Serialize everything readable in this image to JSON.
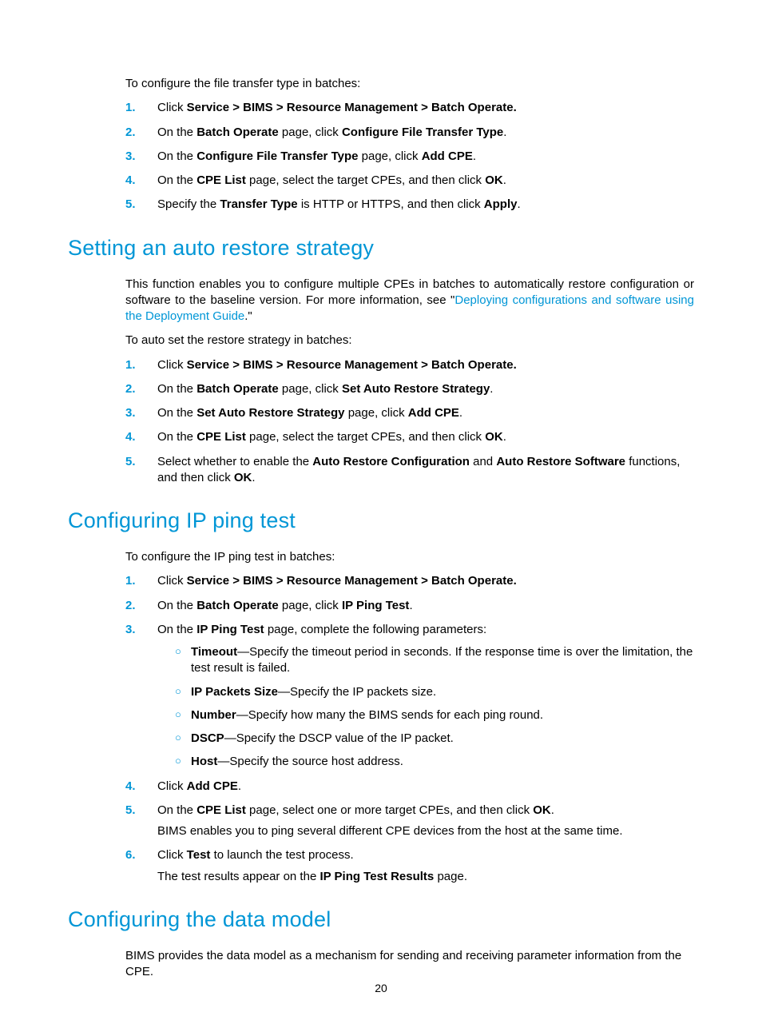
{
  "page_number": "20",
  "section_a": {
    "intro": "To configure the file transfer type in batches:",
    "steps": [
      {
        "n": "1.",
        "pre": "Click ",
        "bold": "Service > BIMS > Resource Management > Batch Operate.",
        "post": ""
      },
      {
        "n": "2.",
        "pre": "On the ",
        "b1": "Batch Operate",
        "mid": " page, click ",
        "b2": "Configure File Transfer Type",
        "post": "."
      },
      {
        "n": "3.",
        "pre": "On the ",
        "b1": "Configure File Transfer Type",
        "mid": " page, click ",
        "b2": "Add CPE",
        "post": "."
      },
      {
        "n": "4.",
        "pre": "On the ",
        "b1": "CPE List",
        "mid": " page, select the target CPEs, and then click ",
        "b2": "OK",
        "post": "."
      },
      {
        "n": "5.",
        "pre": "Specify the ",
        "b1": "Transfer Type",
        "mid": " is HTTP or HTTPS, and then click ",
        "b2": "Apply",
        "post": "."
      }
    ]
  },
  "section_b": {
    "heading": "Setting an auto restore strategy",
    "intro_pre": "This function enables you to configure multiple CPEs in batches to automatically restore configuration or software to the baseline version. For more information, see \"",
    "intro_link": "Deploying configurations and software using the Deployment Guide",
    "intro_post": ".\"",
    "intro2": "To auto set the restore strategy in batches:",
    "steps": [
      {
        "n": "1.",
        "pre": "Click ",
        "bold": "Service > BIMS > Resource Management > Batch Operate.",
        "post": ""
      },
      {
        "n": "2.",
        "pre": "On the ",
        "b1": "Batch Operate",
        "mid": " page, click ",
        "b2": "Set Auto Restore Strategy",
        "post": "."
      },
      {
        "n": "3.",
        "pre": "On the ",
        "b1": "Set Auto Restore Strategy",
        "mid": " page, click ",
        "b2": "Add CPE",
        "post": "."
      },
      {
        "n": "4.",
        "pre": "On the ",
        "b1": "CPE List",
        "mid": " page, select the target CPEs, and then click ",
        "b2": "OK",
        "post": "."
      }
    ],
    "step5": {
      "n": "5.",
      "t1": "Select whether to enable the ",
      "b1": "Auto Restore Configuration",
      "t2": " and ",
      "b2": "Auto Restore Software",
      "t3": " functions, and then click ",
      "b3": "OK",
      "t4": "."
    }
  },
  "section_c": {
    "heading": "Configuring IP ping test",
    "intro": "To configure the IP ping test in batches:",
    "steps12": [
      {
        "n": "1.",
        "pre": "Click ",
        "bold": "Service > BIMS > Resource Management > Batch Operate.",
        "post": ""
      },
      {
        "n": "2.",
        "pre": "On the ",
        "b1": "Batch Operate",
        "mid": " page, click ",
        "b2": "IP Ping Test",
        "post": "."
      }
    ],
    "step3": {
      "n": "3.",
      "pre": "On the ",
      "b1": "IP Ping Test",
      "post": " page, complete the following parameters:"
    },
    "subs": [
      {
        "b": "Timeout",
        "t": "—Specify the timeout period in seconds. If the response time is over the limitation, the test result is failed."
      },
      {
        "b": "IP Packets Size",
        "t": "—Specify the IP packets size."
      },
      {
        "b": "Number",
        "t": "—Specify how many the BIMS sends for each ping round."
      },
      {
        "b": "DSCP",
        "t": "—Specify the DSCP value of the IP packet."
      },
      {
        "b": "Host",
        "t": "—Specify the source host address."
      }
    ],
    "step4": {
      "n": "4.",
      "pre": "Click ",
      "b1": "Add CPE",
      "post": "."
    },
    "step5": {
      "n": "5.",
      "pre": "On the ",
      "b1": "CPE List",
      "mid": " page, select one or more target CPEs, and then click ",
      "b2": "OK",
      "post": ".",
      "extra": "BIMS enables you to ping several different CPE devices from the host at the same time."
    },
    "step6": {
      "n": "6.",
      "pre": "Click ",
      "b1": "Test",
      "post": " to launch the test process.",
      "extra_pre": "The test results appear on the ",
      "extra_b": "IP Ping Test Results",
      "extra_post": " page."
    }
  },
  "section_d": {
    "heading": "Configuring the data model",
    "intro": "BIMS provides the data model as a mechanism for sending and receiving parameter information from the CPE."
  }
}
